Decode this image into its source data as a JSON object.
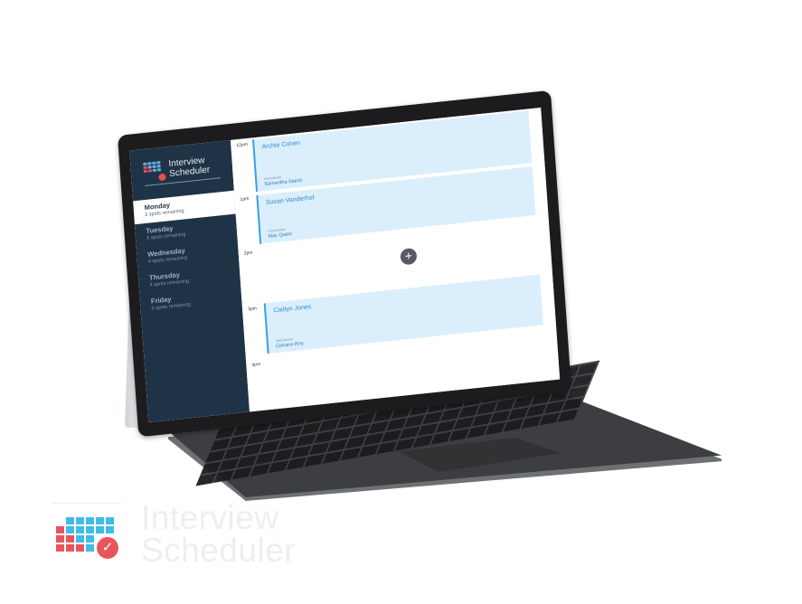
{
  "app": {
    "title_line1": "Interview",
    "title_line2": "Scheduler"
  },
  "sidebar": {
    "days": [
      {
        "name": "Monday",
        "remaining": "2 spots remaining"
      },
      {
        "name": "Tuesday",
        "remaining": "5 spots remaining"
      },
      {
        "name": "Wednesday",
        "remaining": "4 spots remaining"
      },
      {
        "name": "Thursday",
        "remaining": "4 spots remaining"
      },
      {
        "name": "Friday",
        "remaining": "5 spots remaining"
      }
    ],
    "active_day": "Monday"
  },
  "schedule": {
    "times": [
      "12pm",
      "1pm",
      "2pm",
      "3pm",
      "4pm"
    ],
    "appointments": [
      {
        "candidate": "Archie Cohen",
        "role_label": "Interviewer",
        "interviewer": "Samantha Stanic"
      },
      {
        "candidate": "Susan Vanderhof",
        "role_label": "Interviewer",
        "interviewer": "Mac Quinn"
      },
      {
        "candidate": "Caitlyn Jones",
        "role_label": "Interviewer",
        "interviewer": "Cohana Roy"
      }
    ],
    "add_button": "+"
  },
  "watermark": {
    "line1": "Interview",
    "line2": "Scheduler",
    "check_glyph": "✓"
  },
  "colors": {
    "sidebar_bg": "#1f3346",
    "accent_blue": "#3aa1e2",
    "slot_bg": "#dbeefb",
    "brand_red": "#e84c55"
  },
  "icons": [
    "calendar-logo-icon",
    "plus-icon",
    "check-icon"
  ]
}
